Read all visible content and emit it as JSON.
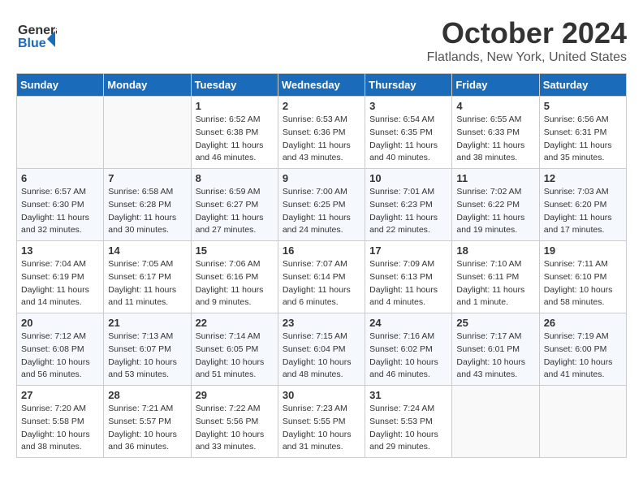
{
  "header": {
    "logo_general": "General",
    "logo_blue": "Blue",
    "month": "October 2024",
    "location": "Flatlands, New York, United States"
  },
  "weekdays": [
    "Sunday",
    "Monday",
    "Tuesday",
    "Wednesday",
    "Thursday",
    "Friday",
    "Saturday"
  ],
  "weeks": [
    [
      {
        "day": "",
        "info": ""
      },
      {
        "day": "",
        "info": ""
      },
      {
        "day": "1",
        "info": "Sunrise: 6:52 AM\nSunset: 6:38 PM\nDaylight: 11 hours and 46 minutes."
      },
      {
        "day": "2",
        "info": "Sunrise: 6:53 AM\nSunset: 6:36 PM\nDaylight: 11 hours and 43 minutes."
      },
      {
        "day": "3",
        "info": "Sunrise: 6:54 AM\nSunset: 6:35 PM\nDaylight: 11 hours and 40 minutes."
      },
      {
        "day": "4",
        "info": "Sunrise: 6:55 AM\nSunset: 6:33 PM\nDaylight: 11 hours and 38 minutes."
      },
      {
        "day": "5",
        "info": "Sunrise: 6:56 AM\nSunset: 6:31 PM\nDaylight: 11 hours and 35 minutes."
      }
    ],
    [
      {
        "day": "6",
        "info": "Sunrise: 6:57 AM\nSunset: 6:30 PM\nDaylight: 11 hours and 32 minutes."
      },
      {
        "day": "7",
        "info": "Sunrise: 6:58 AM\nSunset: 6:28 PM\nDaylight: 11 hours and 30 minutes."
      },
      {
        "day": "8",
        "info": "Sunrise: 6:59 AM\nSunset: 6:27 PM\nDaylight: 11 hours and 27 minutes."
      },
      {
        "day": "9",
        "info": "Sunrise: 7:00 AM\nSunset: 6:25 PM\nDaylight: 11 hours and 24 minutes."
      },
      {
        "day": "10",
        "info": "Sunrise: 7:01 AM\nSunset: 6:23 PM\nDaylight: 11 hours and 22 minutes."
      },
      {
        "day": "11",
        "info": "Sunrise: 7:02 AM\nSunset: 6:22 PM\nDaylight: 11 hours and 19 minutes."
      },
      {
        "day": "12",
        "info": "Sunrise: 7:03 AM\nSunset: 6:20 PM\nDaylight: 11 hours and 17 minutes."
      }
    ],
    [
      {
        "day": "13",
        "info": "Sunrise: 7:04 AM\nSunset: 6:19 PM\nDaylight: 11 hours and 14 minutes."
      },
      {
        "day": "14",
        "info": "Sunrise: 7:05 AM\nSunset: 6:17 PM\nDaylight: 11 hours and 11 minutes."
      },
      {
        "day": "15",
        "info": "Sunrise: 7:06 AM\nSunset: 6:16 PM\nDaylight: 11 hours and 9 minutes."
      },
      {
        "day": "16",
        "info": "Sunrise: 7:07 AM\nSunset: 6:14 PM\nDaylight: 11 hours and 6 minutes."
      },
      {
        "day": "17",
        "info": "Sunrise: 7:09 AM\nSunset: 6:13 PM\nDaylight: 11 hours and 4 minutes."
      },
      {
        "day": "18",
        "info": "Sunrise: 7:10 AM\nSunset: 6:11 PM\nDaylight: 11 hours and 1 minute."
      },
      {
        "day": "19",
        "info": "Sunrise: 7:11 AM\nSunset: 6:10 PM\nDaylight: 10 hours and 58 minutes."
      }
    ],
    [
      {
        "day": "20",
        "info": "Sunrise: 7:12 AM\nSunset: 6:08 PM\nDaylight: 10 hours and 56 minutes."
      },
      {
        "day": "21",
        "info": "Sunrise: 7:13 AM\nSunset: 6:07 PM\nDaylight: 10 hours and 53 minutes."
      },
      {
        "day": "22",
        "info": "Sunrise: 7:14 AM\nSunset: 6:05 PM\nDaylight: 10 hours and 51 minutes."
      },
      {
        "day": "23",
        "info": "Sunrise: 7:15 AM\nSunset: 6:04 PM\nDaylight: 10 hours and 48 minutes."
      },
      {
        "day": "24",
        "info": "Sunrise: 7:16 AM\nSunset: 6:02 PM\nDaylight: 10 hours and 46 minutes."
      },
      {
        "day": "25",
        "info": "Sunrise: 7:17 AM\nSunset: 6:01 PM\nDaylight: 10 hours and 43 minutes."
      },
      {
        "day": "26",
        "info": "Sunrise: 7:19 AM\nSunset: 6:00 PM\nDaylight: 10 hours and 41 minutes."
      }
    ],
    [
      {
        "day": "27",
        "info": "Sunrise: 7:20 AM\nSunset: 5:58 PM\nDaylight: 10 hours and 38 minutes."
      },
      {
        "day": "28",
        "info": "Sunrise: 7:21 AM\nSunset: 5:57 PM\nDaylight: 10 hours and 36 minutes."
      },
      {
        "day": "29",
        "info": "Sunrise: 7:22 AM\nSunset: 5:56 PM\nDaylight: 10 hours and 33 minutes."
      },
      {
        "day": "30",
        "info": "Sunrise: 7:23 AM\nSunset: 5:55 PM\nDaylight: 10 hours and 31 minutes."
      },
      {
        "day": "31",
        "info": "Sunrise: 7:24 AM\nSunset: 5:53 PM\nDaylight: 10 hours and 29 minutes."
      },
      {
        "day": "",
        "info": ""
      },
      {
        "day": "",
        "info": ""
      }
    ]
  ]
}
